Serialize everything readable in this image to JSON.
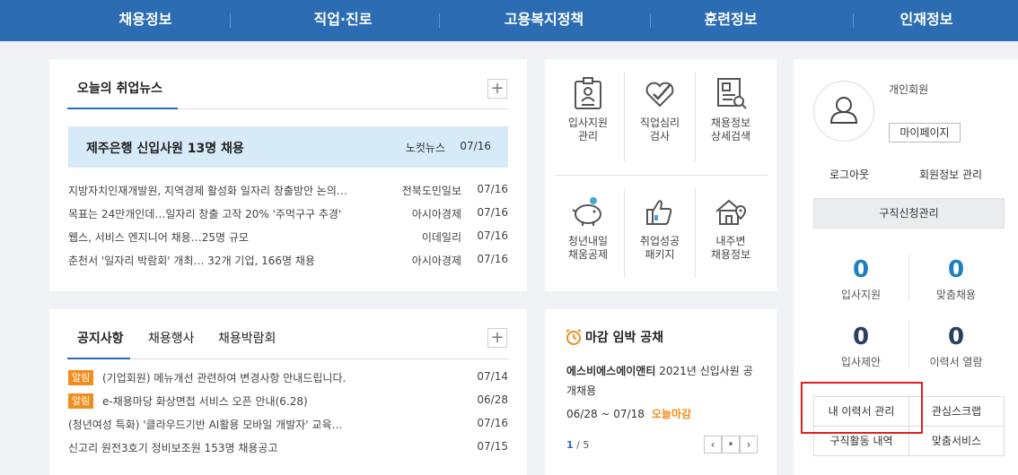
{
  "nav": {
    "items": [
      "채용정보",
      "직업·진로",
      "고용복지정책",
      "훈련정보",
      "인재정보"
    ]
  },
  "news": {
    "tab_label": "오늘의 취업뉴스",
    "plus": "+",
    "headline": {
      "title": "제주은행 신입사원 13명 채용",
      "source": "노컷뉴스",
      "date": "07/16"
    },
    "items": [
      {
        "title": "지방자치인재개발원, 지역경제 활성화 일자리 창출방안 논의…",
        "source": "전북도민일보",
        "date": "07/16"
      },
      {
        "title": "목표는 24만개인데…일자리 창출 고작 20% '주먹구구 추경'",
        "source": "아시아경제",
        "date": "07/16"
      },
      {
        "title": "웹스, 서비스 엔지니어 채용…25명 규모",
        "source": "이데일리",
        "date": "07/16"
      },
      {
        "title": "춘천서 '일자리 박람회' 개최… 32개 기업, 166명 채용",
        "source": "아시아경제",
        "date": "07/16"
      }
    ]
  },
  "notice": {
    "tabs": [
      "공지사항",
      "채용행사",
      "채용박람회"
    ],
    "plus": "+",
    "items": [
      {
        "tag": "알림",
        "title": "(기업회원) 메뉴개선 관련하여 변경사항 안내드립니다.",
        "date": "07/14"
      },
      {
        "tag": "알림",
        "title": "e-채용마당 화상면접 서비스 오픈 안내(6.28)",
        "date": "06/28"
      },
      {
        "tag": "",
        "title": "(청년여성 특화) '클라우드기반 AI활용 모바일 개발자' 교육…",
        "date": "07/16"
      },
      {
        "tag": "",
        "title": "신고리 원전3호기 정비보조원 153명 채용공고",
        "date": "07/15"
      }
    ]
  },
  "services": [
    {
      "line1": "입사지원",
      "line2": "관리",
      "icon": "id-card-icon"
    },
    {
      "line1": "직업심리",
      "line2": "검사",
      "icon": "heart-check-icon"
    },
    {
      "line1": "채용정보",
      "line2": "상세검색",
      "icon": "document-search-icon"
    },
    {
      "line1": "청년내일",
      "line2": "채움공제",
      "icon": "piggy-bank-icon"
    },
    {
      "line1": "취업성공",
      "line2": "패키지",
      "icon": "thumbs-up-icon"
    },
    {
      "line1": "내주변",
      "line2": "채용정보",
      "icon": "house-location-icon"
    }
  ],
  "deadline": {
    "title": "마감 임박 공채",
    "company": "에스비에스에이앤티",
    "description": "2021년 신입사원 공개채용",
    "period": "06/28 ~ 07/18",
    "today_label": "오늘마감",
    "page_current": "1",
    "page_total": "/ 5",
    "prev": "‹",
    "pause": "⏸",
    "next": "›"
  },
  "member": {
    "type_label": "개인회원",
    "mypage": "마이페이지",
    "logout": "로그아웃",
    "edit_info": "회원정보 관리",
    "job_request": "구직신청관리",
    "counts": [
      {
        "value": "0",
        "label": "입사지원",
        "color": "#1c7fc4"
      },
      {
        "value": "0",
        "label": "맞춤채용",
        "color": "#1c7fc4"
      },
      {
        "value": "0",
        "label": "입사제안",
        "color": "#2b3e63"
      },
      {
        "value": "0",
        "label": "이력서 열람",
        "color": "#2b3e63"
      }
    ],
    "buttons": [
      "내 이력서 관리",
      "관심스크랩",
      "구직활동 내역",
      "맞춤서비스"
    ]
  }
}
